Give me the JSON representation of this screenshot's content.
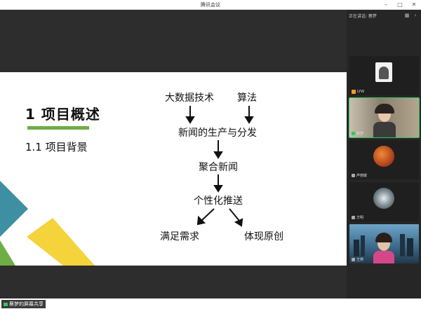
{
  "window": {
    "title": "腾讯会议"
  },
  "sidebar": {
    "speaking_label": "正在讲话: 蔡梦",
    "participants": [
      {
        "name": "LYW"
      },
      {
        "name": "蔡梦"
      },
      {
        "name": "芦丽媛"
      },
      {
        "name": "方明"
      },
      {
        "name": "王燕"
      }
    ]
  },
  "slide": {
    "title": "1 项目概述",
    "subtitle": "1.1 项目背景",
    "diagram": {
      "node_bigdata": "大数据技术",
      "node_algorithm": "算法",
      "node_production": "新闻的生产与分发",
      "node_aggregate": "聚合新闻",
      "node_personalize": "个性化推送",
      "node_satisfy": "满足需求",
      "node_originality": "体现原创"
    }
  },
  "footer": {
    "share_label": "蔡梦的屏幕共享"
  },
  "colors": {
    "accent_green": "#6fae44",
    "teal": "#3f8fa3",
    "yellow": "#f4d33b",
    "speaker_outline": "#30c85a"
  }
}
